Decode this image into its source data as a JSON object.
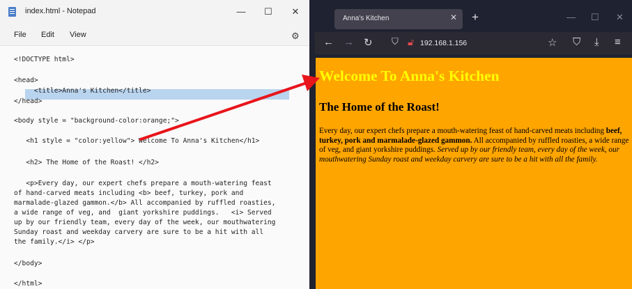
{
  "notepad": {
    "title": "index.html - Notepad",
    "controls": {
      "minimize": "—",
      "maximize": "☐",
      "close": "✕"
    },
    "menu": [
      "File",
      "Edit",
      "View"
    ],
    "code_lines": [
      "<!DOCTYPE html>",
      "<head>",
      "     <title>Anna's Kitchen</title>",
      "</head>",
      "<body style = \"background-color:orange;\">",
      "   <h1 style = \"color:yellow\"> Welcome To Anna's Kitchen</h1>",
      "   <h2> The Home of the Roast! </h2>",
      "   <p>Every day, our expert chefs prepare a mouth-watering feast",
      "of hand-carved meats including <b> beef, turkey, pork and",
      "marmalade-glazed gammon.</b> All accompanied by ruffled roasties,",
      "a wide range of veg, and  giant yorkshire puddings.   <i> Served",
      "up by our friendly team, every day of the week, our mouthwatering",
      "Sunday roast and weekday carvery are sure to be a hit with all",
      "the family.</i> </p>",
      "</body>",
      "</html>"
    ]
  },
  "browser": {
    "tab_title": "Anna's Kitchen",
    "tab_close": "✕",
    "new_tab": "+",
    "window_controls": {
      "minimize": "—",
      "maximize": "☐",
      "close": "✕"
    },
    "url": "192.168.1.156",
    "page": {
      "h1": "Welcome To Anna's Kitchen",
      "h2": "The Home of the Roast!",
      "p_plain1": "Every day, our expert chefs prepare a mouth-watering feast of hand-carved meats including ",
      "p_bold": "beef, turkey, pork and marmalade-glazed gammon.",
      "p_plain2": " All accompanied by ruffled roasties, a wide range of veg, and giant yorkshire puddings. ",
      "p_italic": "Served up by our friendly team, every day of the week, our mouthwatering Sunday roast and weekday carvery are sure to be a hit with all the family."
    }
  },
  "colors": {
    "page_background": "#ffa500",
    "heading_yellow": "#ffff00",
    "selection_highlight": "#b9d4ee",
    "annotation_arrow": "#e8151b"
  },
  "icons": {
    "notepad_app": "notepad-icon",
    "settings": "gear-icon",
    "back": "back-arrow-icon",
    "forward": "forward-arrow-icon",
    "reload": "reload-icon",
    "tracking": "shield-icon",
    "insecure": "lock-warning-icon",
    "bookmark": "star-icon",
    "pocket": "pocket-icon",
    "downloads": "download-icon",
    "menu": "hamburger-icon"
  }
}
